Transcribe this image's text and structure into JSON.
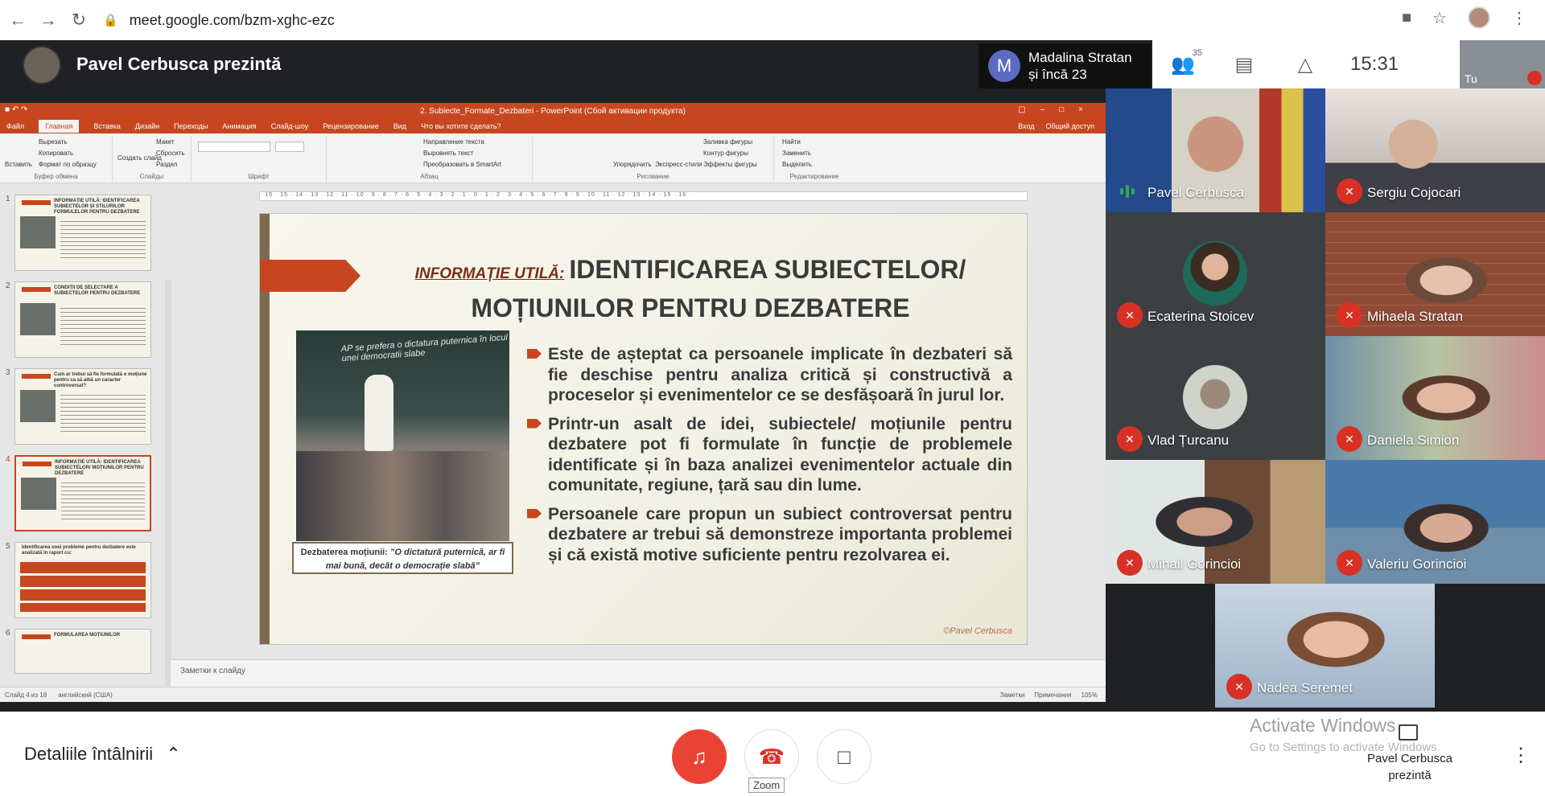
{
  "browser": {
    "url": "meet.google.com/bzm-xghc-ezc",
    "back_icon": "arrow-left-icon",
    "forward_icon": "arrow-right-icon",
    "reload_icon": "reload-icon"
  },
  "meet_header": {
    "presenter_title": "Pavel Cerbusca prezintă",
    "chip_initial": "M",
    "chip_line1": "Madalina Stratan",
    "chip_line2": "și încă 23",
    "people_count": "35",
    "time": "15:31",
    "self_label": "Tu"
  },
  "ppt": {
    "window_title": "2. Subiecte_Formate_Dezbateri - PowerPoint (Сбой активации продукта)",
    "tabs": [
      "Файл",
      "Главная",
      "Вставка",
      "Дизайн",
      "Переходы",
      "Анимация",
      "Слайд-шоу",
      "Рецензирование",
      "Вид"
    ],
    "tell_me": "Что вы хотите сделать?",
    "sign_in": "Вход",
    "share": "Общий доступ",
    "ribbon": {
      "paste": "Вставить",
      "cut": "Вырезать",
      "copy": "Копировать",
      "format_painter": "Формат по образцу",
      "clipboard": "Буфер обмена",
      "new_slide": "Создать слайд",
      "layout": "Макет",
      "reset": "Сбросить",
      "section": "Раздел",
      "slides": "Слайды",
      "font": "Шрифт",
      "text_direction": "Направление текста",
      "align_text": "Выровнять текст",
      "smartart": "Преобразовать в SmartArt",
      "paragraph": "Абзац",
      "arrange": "Упорядочить",
      "quick_styles": "Экспресс-стили",
      "shape_fill": "Заливка фигуры",
      "shape_outline": "Контур фигуры",
      "shape_effects": "Эффекты фигуры",
      "drawing": "Рисование",
      "find": "Найти",
      "replace": "Заменить",
      "select": "Выделить",
      "editing": "Редактирование"
    },
    "thumbnails": [
      {
        "num": "1",
        "title": "INFORMAȚIE UTILĂ: IDENTIFICAREA SUBIECTELOR ȘI STILURILOR FORMULELOR PENTRU DEZBATERE"
      },
      {
        "num": "2",
        "title": "CONDIȚII DE SELECTARE A SUBIECTELOR PENTRU DEZBATERE"
      },
      {
        "num": "3",
        "title": "Cum ar trebui să fie formulată o moțiune pentru ca să aibă un caracter controversat?"
      },
      {
        "num": "4",
        "title": "INFORMAȚIE UTILĂ: IDENTIFICAREA SUBIECTELOR/ MOȚIUNILOR PENTRU DEZBATERE"
      },
      {
        "num": "5",
        "title": "Identificarea unei probleme pentru dezbatere este analizată în raport cu:"
      },
      {
        "num": "6",
        "title": "FORMULAREA MOȚIUNILOR"
      }
    ],
    "slide": {
      "title_lead": "INFORMAȚIE UTILĂ:",
      "title_main": "IDENTIFICAREA SUBIECTELOR/ MOȚIUNILOR PENTRU DEZBATERE",
      "board_text": "AP se prefera o dictatura puternica în locul unei democratii slabe",
      "caption_lead": "Dezbaterea moțiunii:",
      "caption_quote": "”O dictatură puternică, ar fi mai bună, decât o democrație slabă”",
      "bullets": [
        "Este de așteptat ca persoanele implicate în dezbateri să fie deschise pentru analiza critică și constructivă a proceselor și evenimentelor ce se desfășoară în jurul lor.",
        "Printr-un asalt de idei, subiectele/ moțiunile pentru dezbatere pot fi formulate în funcție de problemele identificate și în baza analizei evenimentelor actuale din comunitate, regiune, țară sau din lume.",
        "Persoanele care propun un subiect controversat pentru dezbatere ar trebui să demonstreze importanta problemei și că există motive suficiente pentru rezolvarea ei."
      ],
      "footer": "©Pavel Cerbusca"
    },
    "notes_placeholder": "Заметки к слайду",
    "status": {
      "slide_of": "Слайд 4 из 18",
      "language": "английский (США)",
      "notes": "Заметки",
      "comments": "Примечания",
      "zoom": "105%"
    }
  },
  "participants": [
    {
      "name": "Pavel Cerbusca",
      "muted": false
    },
    {
      "name": "Sergiu Cojocari",
      "muted": true
    },
    {
      "name": "Ecaterina Stoicev",
      "muted": true
    },
    {
      "name": "Mihaela Stratan",
      "muted": true
    },
    {
      "name": "Vlad Țurcanu",
      "muted": true
    },
    {
      "name": "Daniela Simion",
      "muted": true
    },
    {
      "name": "Mihail Gorincioi",
      "muted": true
    },
    {
      "name": "Valeriu Gorincioi",
      "muted": true
    },
    {
      "name": "Nadea Seremet",
      "muted": true
    }
  ],
  "bottom_bar": {
    "details": "Detaliile întâlnirii",
    "zoom_tooltip": "Zoom",
    "activate_line1": "Activate Windows",
    "activate_line2": "Go to Settings to activate Windows.",
    "presenting_line1": "Pavel Cerbusca",
    "presenting_line2": "prezintă"
  },
  "colors": {
    "ppt_accent": "#c7461f",
    "meet_dark": "#202124",
    "mic_red": "#ea4335",
    "speaking_green": "#34a853"
  }
}
